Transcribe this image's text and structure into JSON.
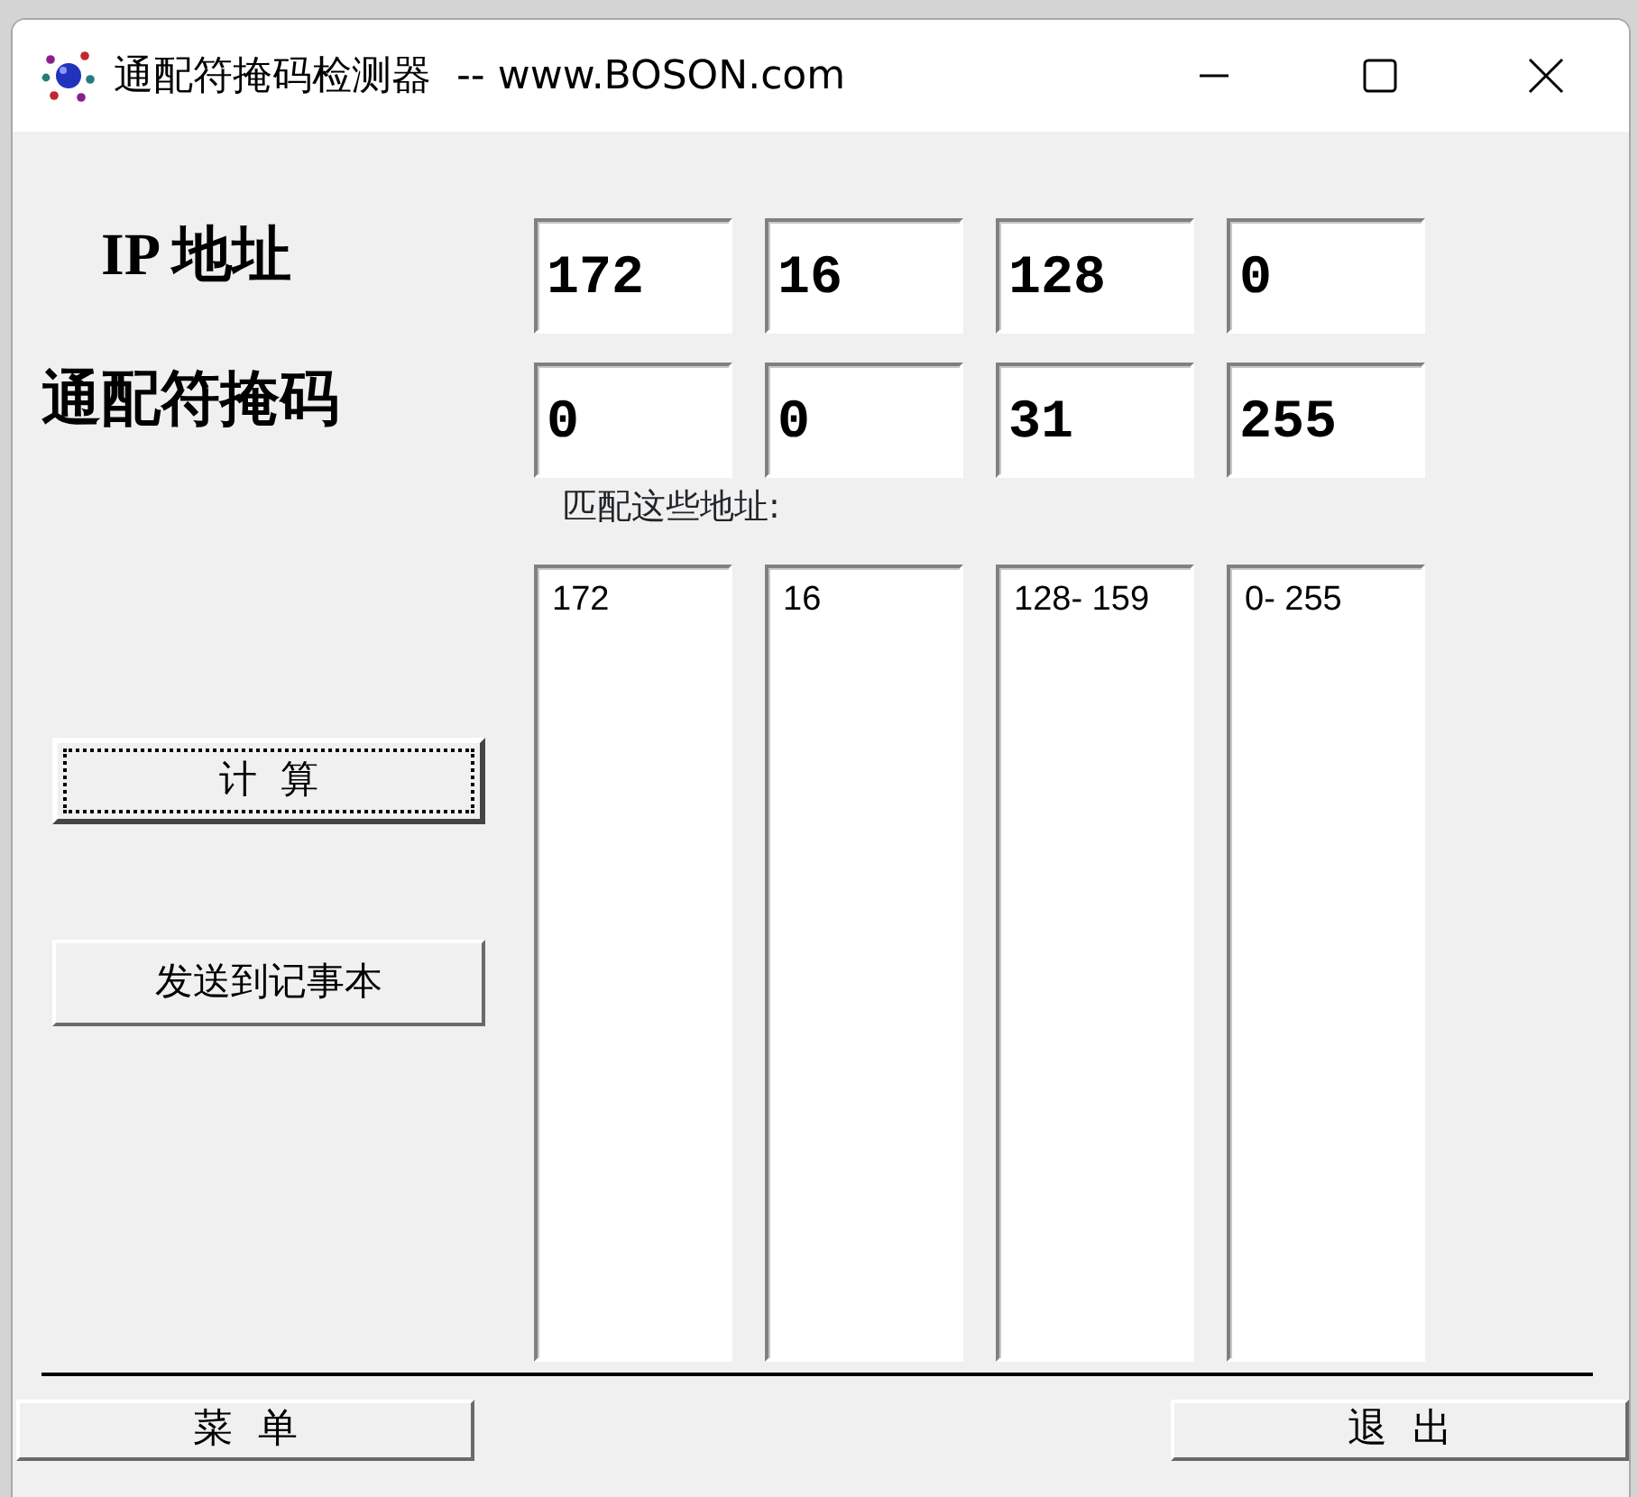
{
  "window": {
    "title": "通配符掩码检测器  -- www.BOSON.com"
  },
  "ip_address": {
    "label": "IP 地址",
    "octets": [
      "172",
      "16",
      "128",
      "0"
    ]
  },
  "wildcard_mask": {
    "label": "通配符掩码",
    "octets": [
      "0",
      "0",
      "31",
      "255"
    ]
  },
  "matches": {
    "label": "匹配这些地址:",
    "ranges": [
      "172",
      "16",
      "128- 159",
      "0- 255"
    ]
  },
  "buttons": [
    {
      "label": "计  算",
      "focused": true
    },
    {
      "label": "发送到记事本",
      "focused": false
    }
  ],
  "bottom_buttons": [
    "菜  单",
    "退  出"
  ]
}
